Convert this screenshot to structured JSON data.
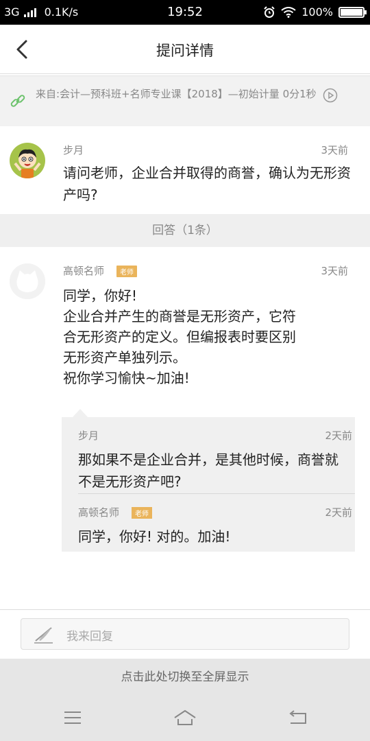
{
  "status_bar": {
    "network": "3G",
    "speed": "0.1K/s",
    "time": "19:52",
    "battery": "100%"
  },
  "header": {
    "title": "提问详情"
  },
  "source": {
    "text": "来自:会计—预科班+名师专业课【2018】—初始计量 0分1秒"
  },
  "question": {
    "author": "步月",
    "time": "3天前",
    "text": "请问老师，企业合并取得的商誉，确认为无形资产吗?"
  },
  "answers_header": "回答（1条）",
  "answer": {
    "author": "高顿名师",
    "badge": "老师",
    "time": "3天前",
    "lines": [
      "同学，你好!",
      "企业合并产生的商誉是无形资产，它符",
      "合无形资产的定义。但编报表时要区别",
      "无形资产单独列示。",
      "祝你学习愉快~加油!"
    ]
  },
  "replies": [
    {
      "author": "步月",
      "time": "2天前",
      "text": "那如果不是企业合并，是其他时候，商誉就不是无形资产吧?"
    },
    {
      "author": "高顿名师",
      "badge": "老师",
      "time": "2天前",
      "text": "同学，你好! 对的。加油!"
    }
  ],
  "reply_input": {
    "placeholder": "我来回复"
  },
  "fullscreen_label": "点击此处切换至全屏显示",
  "icons": {
    "link": "link-icon",
    "play": "play-circle-icon",
    "back": "chevron-left-icon",
    "pen": "pen-icon",
    "menu": "menu-icon",
    "home": "home-icon",
    "return": "return-icon"
  },
  "colors": {
    "badge": "#eab45b",
    "link_icon": "#6cc26c"
  }
}
